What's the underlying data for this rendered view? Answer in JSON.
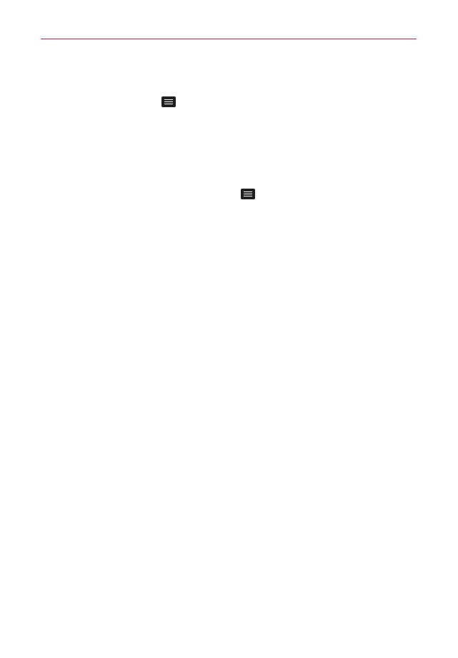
{
  "page": {
    "accent_color": "#b5273a",
    "background_color": "#ffffff"
  },
  "icons": [
    {
      "name": "menu-icon",
      "description": "menu-key"
    },
    {
      "name": "menu-icon",
      "description": "menu-key"
    }
  ]
}
